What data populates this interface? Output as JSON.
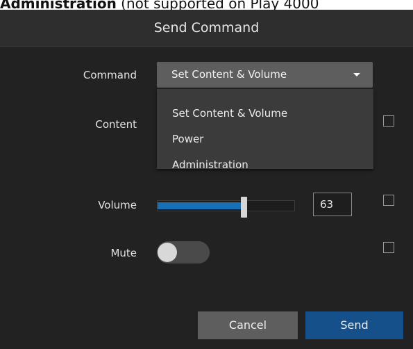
{
  "doc_text": {
    "bold": "Administration",
    "rest": " (not supported on Play 4000"
  },
  "dialog": {
    "title": "Send Command",
    "command": {
      "label": "Command",
      "selected": "Set Content & Volume",
      "options": [
        "Set Content & Volume",
        "Power",
        "Administration"
      ]
    },
    "content": {
      "label": "Content"
    },
    "volume": {
      "label": "Volume",
      "value": "63",
      "level_percent": 63
    },
    "mute": {
      "label": "Mute",
      "state": "off"
    },
    "buttons": {
      "cancel": "Cancel",
      "send": "Send"
    }
  }
}
